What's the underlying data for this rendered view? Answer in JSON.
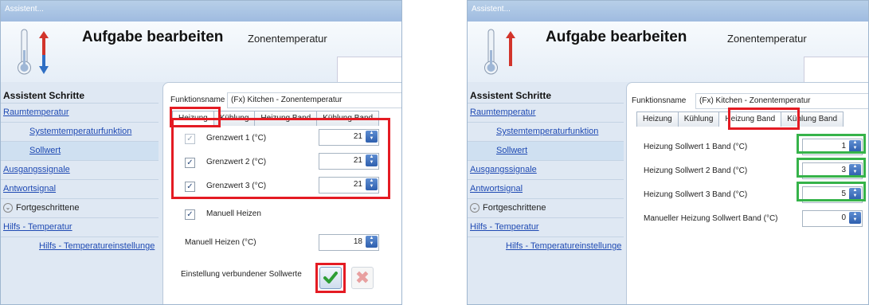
{
  "windows": [
    {
      "title": "Assistent...",
      "header_title": "Aufgabe bearbeiten",
      "header_subtitle": "Zonentemperatur",
      "steps_title": "Assistent Schritte",
      "steps": [
        {
          "label": "Raumtemperatur",
          "level": 1
        },
        {
          "label": "Systemtemperaturfunktion",
          "level": 2
        },
        {
          "label": "Sollwert",
          "level": 2,
          "selected": true
        },
        {
          "label": "Ausgangssignale",
          "level": 1
        },
        {
          "label": "Antwortsignal",
          "level": 1
        },
        {
          "label": "Fortgeschrittene",
          "level": 1,
          "expandable": true
        },
        {
          "label": "Hilfs - Temperatur",
          "level": 1
        },
        {
          "label": "Hilfs - Temperatureinstellunge",
          "level": 3
        }
      ],
      "function_label": "Funktionsname",
      "function_value": "(Fx) Kitchen - Zonentemperatur",
      "tabs": [
        "Heizung",
        "Kühlung",
        "Heizung Band",
        "Kühlung Band"
      ],
      "active_tab": "Heizung",
      "limits": [
        {
          "label": "Grenzwert 1 (°C)",
          "value": "21",
          "checked": true,
          "enabled": false
        },
        {
          "label": "Grenzwert 2 (°C)",
          "value": "21",
          "checked": true,
          "enabled": true
        },
        {
          "label": "Grenzwert 3 (°C)",
          "value": "21",
          "checked": true,
          "enabled": true
        }
      ],
      "manual_heat_label": "Manuell Heizen",
      "manual_heat_checked": true,
      "manual_heat_value_label": "Manuell Heizen (°C)",
      "manual_heat_value": "18",
      "linked_setpoints_label": "Einstellung verbundener Sollwerte"
    },
    {
      "title": "Assistent...",
      "header_title": "Aufgabe bearbeiten",
      "header_subtitle": "Zonentemperatur",
      "steps_title": "Assistent Schritte",
      "steps": [
        {
          "label": "Raumtemperatur",
          "level": 1
        },
        {
          "label": "Systemtemperaturfunktion",
          "level": 2
        },
        {
          "label": "Sollwert",
          "level": 2,
          "selected": true
        },
        {
          "label": "Ausgangssignale",
          "level": 1
        },
        {
          "label": "Antwortsignal",
          "level": 1
        },
        {
          "label": "Fortgeschrittene",
          "level": 1,
          "expandable": true
        },
        {
          "label": "Hilfs - Temperatur",
          "level": 1
        },
        {
          "label": "Hilfs - Temperatureinstellunge",
          "level": 3
        }
      ],
      "function_label": "Funktionsname",
      "function_value": "(Fx) Kitchen - Zonentemperatur",
      "tabs": [
        "Heizung",
        "Kühlung",
        "Heizung Band",
        "Kühlung Band"
      ],
      "active_tab": "Heizung Band",
      "band_setpoints": [
        {
          "label": "Heizung Sollwert 1 Band (°C)",
          "value": "1"
        },
        {
          "label": "Heizung Sollwert 2 Band (°C)",
          "value": "3"
        },
        {
          "label": "Heizung Sollwert 3 Band (°C)",
          "value": "5"
        }
      ],
      "manual_band_label": "Manueller Heizung Sollwert Band (°C)",
      "manual_band_value": "0"
    }
  ],
  "colors": {
    "highlight_red": "#e41b23",
    "highlight_green": "#36b34a",
    "link": "#1f4ab3",
    "selected_step": "#cfe0f1"
  }
}
